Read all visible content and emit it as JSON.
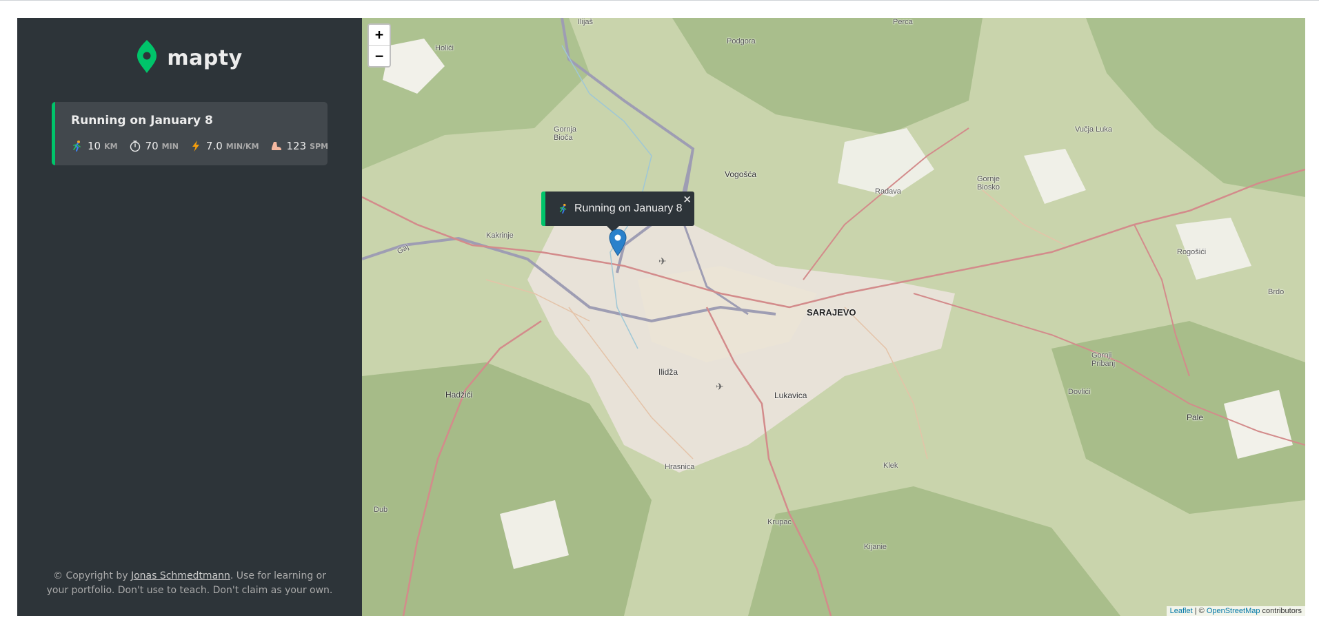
{
  "app": {
    "logo_text": "mapty",
    "accent": "#00c46a"
  },
  "workouts": [
    {
      "title": "Running on January 8",
      "distance": "10",
      "distance_unit": "km",
      "duration": "70",
      "duration_unit": "min",
      "pace": "7.0",
      "pace_unit": "min/km",
      "cadence": "123",
      "cadence_unit": "spm"
    }
  ],
  "footer": {
    "prefix": "© Copyright by ",
    "author": "Jonas Schmedtmann",
    "suffix": ". Use for learning or your portfolio. Don't use to teach. Don't claim as your own."
  },
  "map": {
    "zoom_in": "+",
    "zoom_out": "−",
    "popup_text": "Running on January 8",
    "popup_close": "×",
    "attribution_leaflet": "Leaflet",
    "attribution_sep": " | © ",
    "attribution_osm": "OpenStreetMap",
    "attribution_suffix": " contributors",
    "places": {
      "sarajevo": "SARAJEVO",
      "ilijas": "Ilijaš",
      "perca": "Perca",
      "podgora": "Podgora",
      "holici": "Holići",
      "gornja_biocu": "Gornja Bioča",
      "vogosca": "Vogošća",
      "radava": "Radava",
      "gornje_biosko": "Gornje Biosko",
      "vucja_luka": "Vučja Luka",
      "kakrinje": "Kakrinje",
      "gaj": "Gaj",
      "rogosici": "Rogošići",
      "brdo": "Brdo",
      "ilidza": "Ilidža",
      "hadzici": "Hadžići",
      "lukavica": "Lukavica",
      "gornji_pribanj": "Gornji Pribanj",
      "dovlici": "Dovlići",
      "pale": "Pale",
      "hrasnica": "Hrasnica",
      "klek": "Klek",
      "dub": "Dub",
      "krupac": "Krupac",
      "kijanie": "Kijanie"
    }
  }
}
